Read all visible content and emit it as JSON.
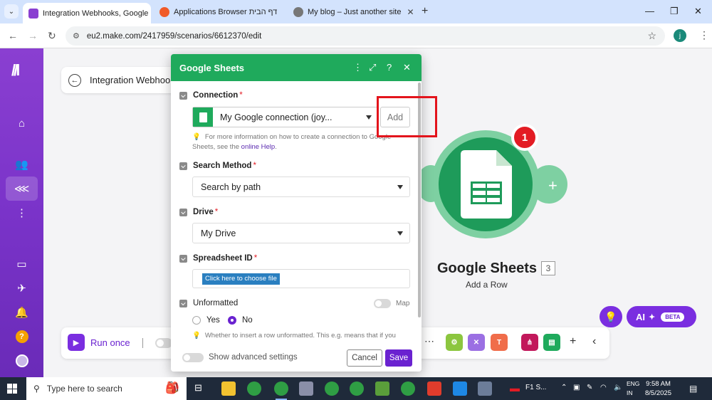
{
  "browser": {
    "tabs": [
      {
        "label": "Integration Webhooks, Google",
        "active": true
      },
      {
        "label": "Applications Browser ‏דף הבית",
        "active": false
      },
      {
        "label": "My blog – Just another site",
        "active": false
      }
    ],
    "url": "eu2.make.com/2417959/scenarios/6612370/edit",
    "profile_initial": "j"
  },
  "scenario": {
    "title": "Integration Webhooks"
  },
  "module": {
    "name": "Google Sheets",
    "count": "3",
    "action": "Add a Row",
    "badge": "1"
  },
  "ai": {
    "label": "AI",
    "beta": "BETA"
  },
  "toolbar": {
    "run_once": "Run once"
  },
  "dialog": {
    "title": "Google Sheets",
    "connection": {
      "label": "Connection",
      "value": "My Google connection (joy...",
      "add_label": "Add",
      "hint_text": "For more information on how to create a connection to Google Sheets, see the ",
      "hint_link": "online Help",
      "hint_end": "."
    },
    "search_method": {
      "label": "Search Method",
      "value": "Search by path"
    },
    "drive": {
      "label": "Drive",
      "value": "My Drive"
    },
    "spreadsheet": {
      "label": "Spreadsheet ID",
      "button": "Click here to choose file"
    },
    "unformatted": {
      "label": "Unformatted",
      "map_label": "Map",
      "options": [
        "Yes",
        "No"
      ],
      "selected": "No",
      "hint": "Whether to insert a row unformatted. This e.g. means that if you"
    },
    "footer": {
      "advanced": "Show advanced settings",
      "cancel": "Cancel",
      "save": "Save"
    }
  },
  "taskbar": {
    "search_placeholder": "Type here to search",
    "f1_label": "F1 S...",
    "lang_top": "ENG",
    "lang_bottom": "IN",
    "time": "9:58 AM",
    "date": "8/5/2025"
  },
  "colors": {
    "make_purple": "#6a22d0",
    "sheets_green": "#1faa5c",
    "highlight_red": "#e3141c"
  }
}
